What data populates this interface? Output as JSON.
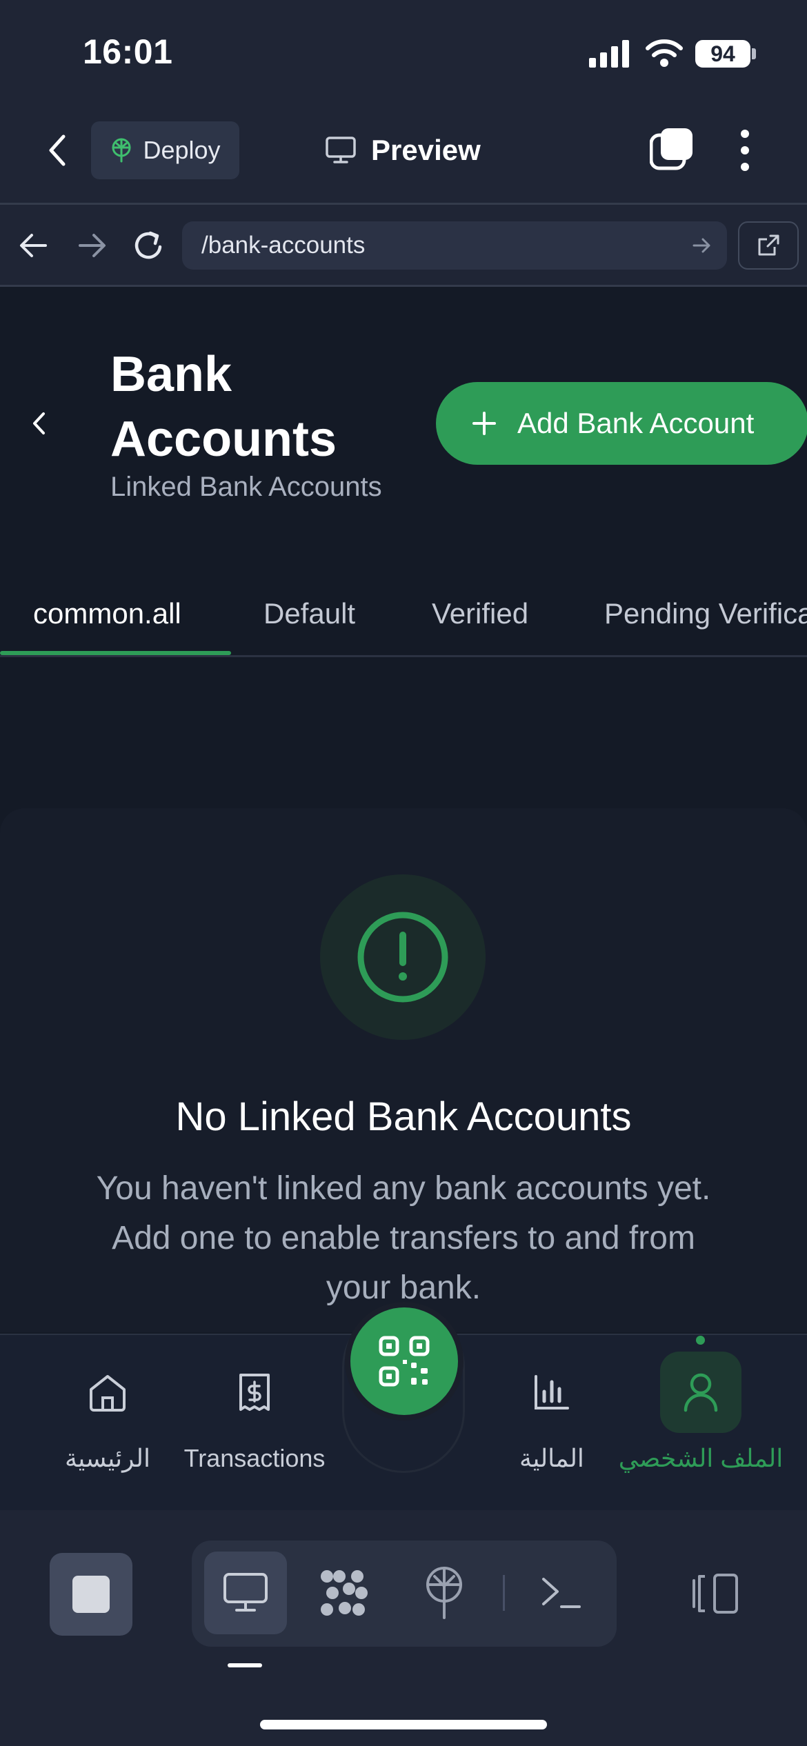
{
  "status_bar": {
    "time": "16:01",
    "battery": "94"
  },
  "app_header": {
    "deploy_label": "Deploy",
    "preview_label": "Preview"
  },
  "browser": {
    "url": "/bank-accounts"
  },
  "page": {
    "title_line1": "Bank",
    "title_line2": "Accounts",
    "subtitle": "Linked Bank Accounts",
    "add_button_label": "Add Bank Account"
  },
  "tabs": [
    {
      "label": "common.all",
      "active": true
    },
    {
      "label": "Default",
      "active": false
    },
    {
      "label": "Verified",
      "active": false
    },
    {
      "label": "Pending Verifica",
      "active": false
    }
  ],
  "empty_state": {
    "title": "No Linked Bank Accounts",
    "description_line1": "You haven't linked any bank accounts yet.",
    "description_line2": "Add one to enable transfers to and from",
    "description_line3": "your bank."
  },
  "bottom_nav": [
    {
      "label": "الرئيسية",
      "icon": "home-icon"
    },
    {
      "label": "Transactions",
      "icon": "receipt-dollar-icon"
    },
    {
      "label": "",
      "icon": "qr-code-icon"
    },
    {
      "label": "المالية",
      "icon": "bar-chart-icon"
    },
    {
      "label": "الملف الشخصي",
      "icon": "user-icon",
      "active": true
    }
  ],
  "colors": {
    "accent": "#2e9c57",
    "background": "#141a26",
    "chrome": "#1f2535",
    "muted_text": "#a9b0bf"
  }
}
